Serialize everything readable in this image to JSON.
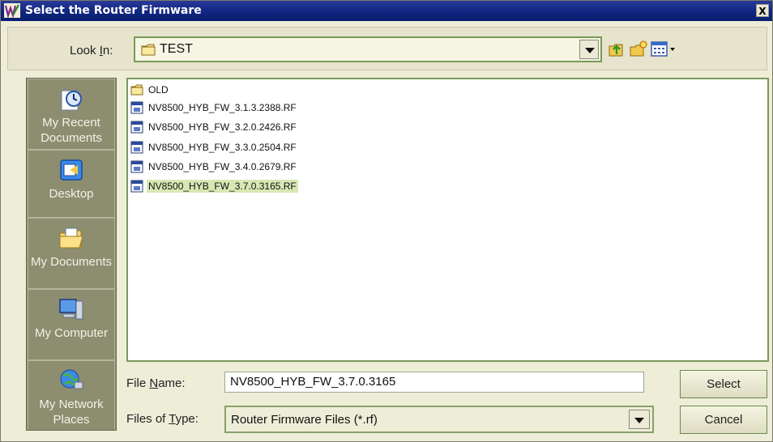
{
  "window": {
    "title": "Select the Router Firmware",
    "close_label": "X"
  },
  "toolbar": {
    "lookin_label_prefix": "Look ",
    "lookin_label_accel": "I",
    "lookin_label_suffix": "n:",
    "current_folder": "TEST",
    "icons": [
      "up-folder-icon",
      "new-folder-icon",
      "view-menu-icon"
    ]
  },
  "places": [
    {
      "label": "My Recent Documents",
      "icon": "recent-documents-icon"
    },
    {
      "label": "Desktop",
      "icon": "desktop-icon"
    },
    {
      "label": "My Documents",
      "icon": "my-documents-icon"
    },
    {
      "label": "My Computer",
      "icon": "my-computer-icon"
    },
    {
      "label": "My Network Places",
      "icon": "network-places-icon"
    }
  ],
  "files": [
    {
      "name": "OLD",
      "type": "folder",
      "selected": false
    },
    {
      "name": "NV8500_HYB_FW_3.1.3.2388.RF",
      "type": "file",
      "selected": false
    },
    {
      "name": "NV8500_HYB_FW_3.2.0.2426.RF",
      "type": "file",
      "selected": false
    },
    {
      "name": "NV8500_HYB_FW_3.3.0.2504.RF",
      "type": "file",
      "selected": false
    },
    {
      "name": "NV8500_HYB_FW_3.4.0.2679.RF",
      "type": "file",
      "selected": false
    },
    {
      "name": "NV8500_HYB_FW_3.7.0.3165.RF",
      "type": "file",
      "selected": true
    }
  ],
  "filename": {
    "label_prefix": "File ",
    "label_accel": "N",
    "label_suffix": "ame:",
    "value": "NV8500_HYB_FW_3.7.0.3165"
  },
  "filetype": {
    "label_prefix": "Files of ",
    "label_accel": "T",
    "label_suffix": "ype:",
    "value": "Router Firmware Files (*.rf)"
  },
  "buttons": {
    "select": "Select",
    "cancel": "Cancel"
  },
  "colors": {
    "titlebar": "#0f2680",
    "accent_border": "#7a9a5a",
    "places_bg": "#8d8d70",
    "selection": "#d8e8b4"
  }
}
